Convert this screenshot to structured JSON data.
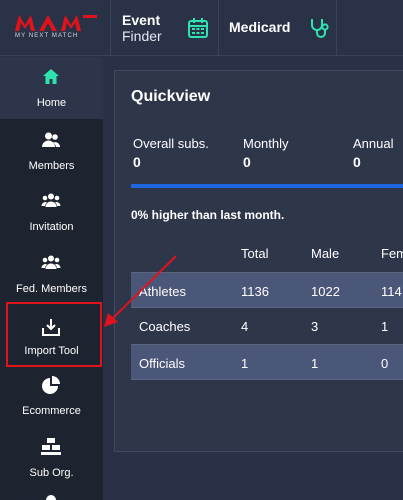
{
  "brand": {
    "logo_text": "MAM",
    "tagline": "MY NEXT MATCH",
    "accent_color": "#e0131b"
  },
  "header": {
    "event_finder": {
      "title": "Event",
      "subtitle": "Finder",
      "icon": "calendar-icon",
      "icon_color": "#2ee3b0"
    },
    "medicard": {
      "title": "Medicard",
      "icon": "stethoscope-icon",
      "icon_color": "#2ee3b0"
    }
  },
  "sidebar": {
    "items": [
      {
        "label": "Home",
        "icon": "home-icon",
        "active": true
      },
      {
        "label": "Members",
        "icon": "members-icon"
      },
      {
        "label": "Invitation",
        "icon": "invitation-icon"
      },
      {
        "label": "Fed. Members",
        "icon": "fed-members-icon"
      },
      {
        "label": "Import Tool",
        "icon": "import-icon",
        "highlighted": true
      },
      {
        "label": "Ecommerce",
        "icon": "pie-chart-icon"
      },
      {
        "label": "Sub Org.",
        "icon": "sub-org-icon"
      }
    ]
  },
  "quickview": {
    "title": "Quickview",
    "stats": [
      {
        "label": "Overall subs.",
        "value": "0"
      },
      {
        "label": "Monthly",
        "value": "0"
      },
      {
        "label": "Annual",
        "value": "0"
      }
    ],
    "progress_fraction": 1.0,
    "progress_color": "#1f67e0",
    "growth_note": "0% higher than last month.",
    "table": {
      "headers": [
        "",
        "Total",
        "Male",
        "Fem"
      ],
      "rows": [
        [
          "Athletes",
          "1136",
          "1022",
          "114"
        ],
        [
          "Coaches",
          "4",
          "3",
          "1"
        ],
        [
          "Officials",
          "1",
          "1",
          "0"
        ]
      ]
    }
  }
}
